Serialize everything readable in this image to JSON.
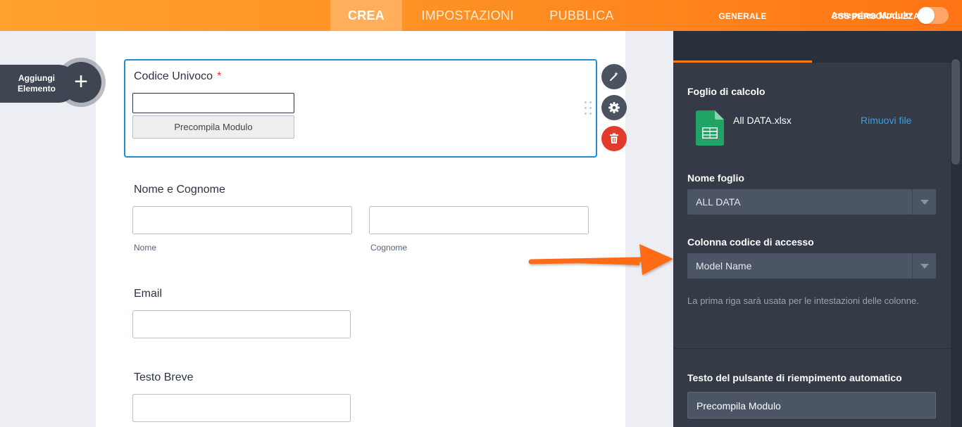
{
  "topbar": {
    "nav": [
      {
        "label": "CREA",
        "active": true
      },
      {
        "label": "IMPOSTAZIONI",
        "active": false
      },
      {
        "label": "PUBBLICA",
        "active": false
      }
    ],
    "preview_label": "Anteprima Modulo",
    "preview_enabled": false
  },
  "add_element": {
    "label": "Aggiungi Elemento",
    "icon": "plus-icon"
  },
  "form": {
    "unique_code": {
      "label": "Codice Univoco",
      "required_mark": "*",
      "value": "",
      "button_label": "Precompila Modulo"
    },
    "full_name": {
      "label": "Nome e Cognome",
      "first_sublabel": "Nome",
      "last_sublabel": "Cognome",
      "first_value": "",
      "last_value": ""
    },
    "email": {
      "label": "Email",
      "value": ""
    },
    "short_text": {
      "label": "Testo Breve",
      "value": ""
    }
  },
  "field_actions": [
    {
      "name": "wand-icon",
      "color": "#4b5361"
    },
    {
      "name": "gear-icon",
      "color": "#4b5361"
    },
    {
      "name": "trash-icon",
      "color": "#e23b2e"
    }
  ],
  "panel": {
    "tabs": [
      {
        "label": "GENERALE",
        "active": true
      },
      {
        "label": "CSS PERSONALIZZATO",
        "active": false
      }
    ],
    "spreadsheet": {
      "label": "Foglio di calcolo",
      "file_name": "All DATA.xlsx",
      "remove_label": "Rimuovi file",
      "file_icon": "spreadsheet-file-icon"
    },
    "sheet_name": {
      "label": "Nome foglio",
      "value": "ALL DATA"
    },
    "access_column": {
      "label": "Colonna codice di accesso",
      "value": "Model Name",
      "help": "La prima riga sarà usata per le intestazioni delle colonne."
    },
    "autofill_button": {
      "label": "Testo del pulsante di riempimento automatico",
      "value": "Precompila Modulo"
    }
  },
  "colors": {
    "accent": "#ff7b1c",
    "selection": "#1e8dd2",
    "panel_bg": "#343b47",
    "link": "#3d9ce4"
  }
}
